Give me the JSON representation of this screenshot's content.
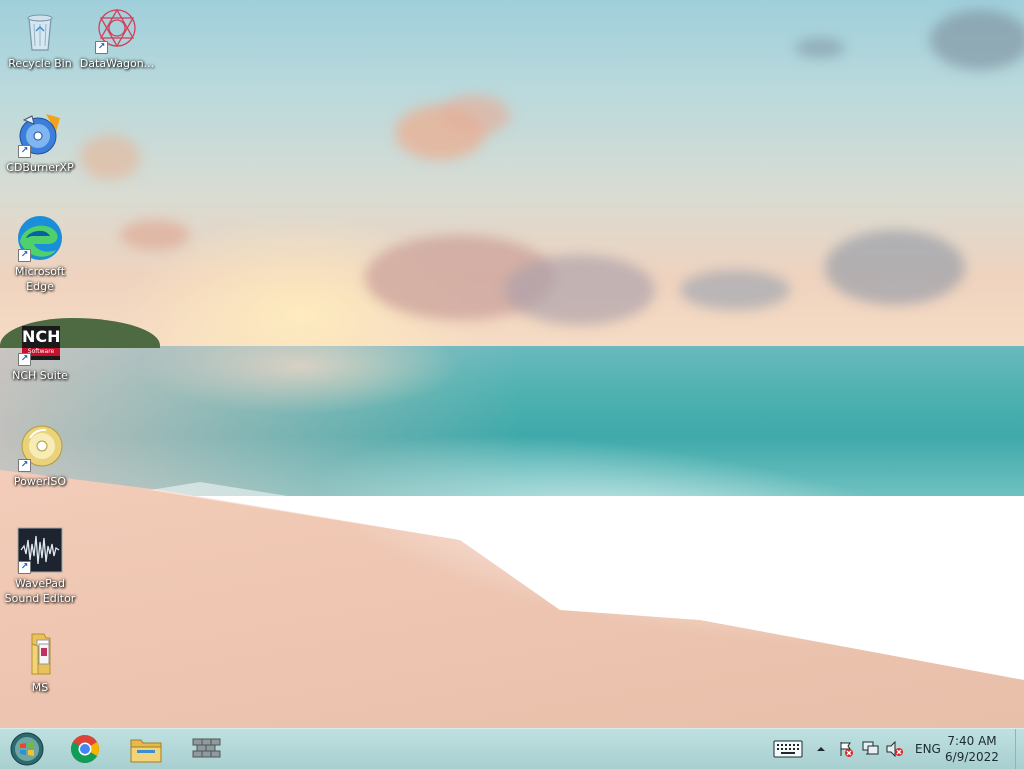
{
  "desktop": {
    "icons": [
      {
        "label": "Recycle Bin",
        "icon": "recycle-bin-icon"
      },
      {
        "label": "DataWagon...",
        "icon": "datawagon-icon"
      },
      {
        "label": "CDBurnerXP",
        "icon": "cdburnerxp-icon"
      },
      {
        "label": "Microsoft Edge",
        "icon": "microsoft-edge-icon"
      },
      {
        "label": "NCH Suite",
        "icon": "nch-suite-icon",
        "badge_text": "NCH",
        "badge_sub": "Software"
      },
      {
        "label": "PowerISO",
        "icon": "poweriso-icon"
      },
      {
        "label": "WavePad Sound Editor",
        "icon": "wavepad-icon"
      },
      {
        "label": "MS",
        "icon": "folder-icon"
      }
    ]
  },
  "taskbar": {
    "pinned": [
      {
        "name": "start-button",
        "icon": "windows-orb-icon"
      },
      {
        "name": "chrome",
        "icon": "chrome-icon"
      },
      {
        "name": "file-explorer",
        "icon": "file-explorer-icon"
      },
      {
        "name": "firewall-app",
        "icon": "brick-wall-icon"
      }
    ],
    "tray": {
      "keyboard_icon": "touch-keyboard-icon",
      "chevron_icon": "show-hidden-icons-icon",
      "action_center_icon": "action-center-icon",
      "network_icon": "network-icon",
      "volume_icon": "volume-muted-icon",
      "language": "ENG"
    },
    "clock": {
      "time": "7:40 AM",
      "date": "6/9/2022"
    }
  },
  "colors": {
    "taskbar_bg": "#a8cfd0",
    "label_text": "#ffffff"
  }
}
